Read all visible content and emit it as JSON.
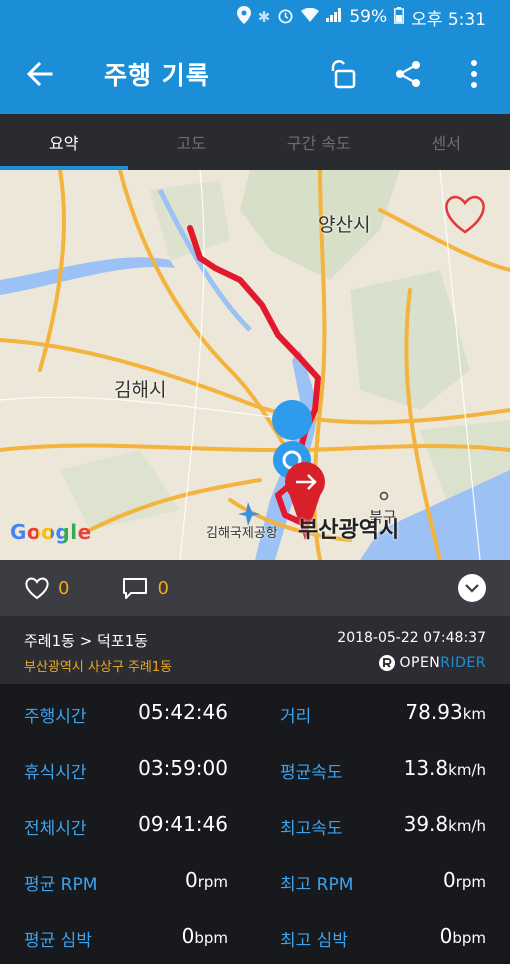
{
  "status": {
    "battery": "59%",
    "time": "오후 5:31"
  },
  "appbar": {
    "title": "주행 기록"
  },
  "tabs": [
    {
      "label": "요약",
      "active": true
    },
    {
      "label": "고도"
    },
    {
      "label": "구간 속도"
    },
    {
      "label": "센서"
    }
  ],
  "map": {
    "labels": {
      "yangsan": "양산시",
      "gimhae": "김해시",
      "busan": "부산광역시",
      "airport": "김해국제공항",
      "buk": "북구"
    },
    "google": "Google"
  },
  "social": {
    "likes": "0",
    "comments": "0"
  },
  "route": {
    "title": "주례1동 > 덕포1동",
    "address": "부산광역시 사상구 주례1동",
    "timestamp": "2018-05-22 07:48:37",
    "brand_open": "OPEN",
    "brand_rider": "RIDER"
  },
  "stats": [
    {
      "label_left": "주행시간",
      "value_left": "05:42:46",
      "unit_left": "",
      "label_right": "거리",
      "value_right": "78.93",
      "unit_right": "km"
    },
    {
      "label_left": "휴식시간",
      "value_left": "03:59:00",
      "unit_left": "",
      "label_right": "평균속도",
      "value_right": "13.8",
      "unit_right": "km/h"
    },
    {
      "label_left": "전체시간",
      "value_left": "09:41:46",
      "unit_left": "",
      "label_right": "최고속도",
      "value_right": "39.8",
      "unit_right": "km/h"
    },
    {
      "label_left": "평균 RPM",
      "value_left": "0",
      "unit_left": "rpm",
      "label_right": "최고 RPM",
      "value_right": "0",
      "unit_right": "rpm"
    },
    {
      "label_left": "평균 심박",
      "value_left": "0",
      "unit_left": "bpm",
      "label_right": "최고 심박",
      "value_right": "0",
      "unit_right": "bpm"
    }
  ]
}
